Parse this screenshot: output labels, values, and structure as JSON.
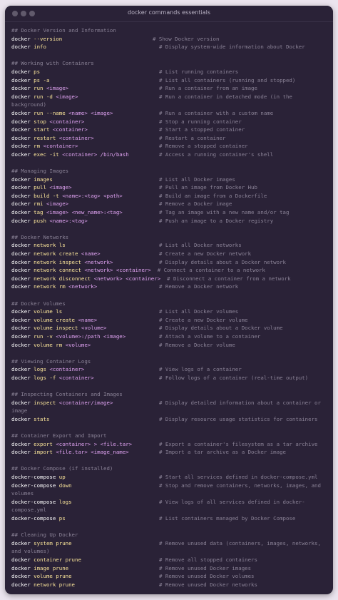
{
  "window": {
    "title": "docker commands essentials"
  },
  "sections": [
    {
      "heading": "## Docker Version and Information",
      "rows": [
        {
          "cmd": "docker",
          "kw": "--version",
          "args": "",
          "desc": "# Show Docker version",
          "shift": true
        },
        {
          "cmd": "docker",
          "kw": "info",
          "args": "",
          "desc": "# Display system-wide information about Docker"
        }
      ]
    },
    {
      "heading": "## Working with Containers",
      "rows": [
        {
          "cmd": "docker",
          "kw": "ps",
          "args": "",
          "desc": "# List running containers"
        },
        {
          "cmd": "docker",
          "kw": "ps -a",
          "args": "",
          "desc": "# List all containers (running and stopped)"
        },
        {
          "cmd": "docker",
          "kw": "run",
          "args": "<image>",
          "desc": "# Run a container from an image"
        },
        {
          "cmd": "docker",
          "kw": "run -d",
          "args": "<image>",
          "desc": "# Run a container in detached mode (in the",
          "wrap": "background)"
        },
        {
          "cmd": "docker",
          "kw": "run --name",
          "args": "<name> <image>",
          "desc": "# Run a container with a custom name"
        },
        {
          "cmd": "docker",
          "kw": "stop",
          "args": "<container>",
          "desc": "# Stop a running container"
        },
        {
          "cmd": "docker",
          "kw": "start",
          "args": "<container>",
          "desc": "# Start a stopped container"
        },
        {
          "cmd": "docker",
          "kw": "restart",
          "args": "<container>",
          "desc": "# Restart a container"
        },
        {
          "cmd": "docker",
          "kw": "rm",
          "args": "<container>",
          "desc": "# Remove a stopped container"
        },
        {
          "cmd": "docker",
          "kw": "exec -it",
          "args": "<container> /bin/bash",
          "desc": "# Access a running container's shell"
        }
      ]
    },
    {
      "heading": "## Managing Images",
      "rows": [
        {
          "cmd": "docker",
          "kw": "images",
          "args": "",
          "desc": "# List all Docker images"
        },
        {
          "cmd": "docker",
          "kw": "pull",
          "args": "<image>",
          "desc": "# Pull an image from Docker Hub"
        },
        {
          "cmd": "docker",
          "kw": "build -t",
          "args": "<name>:<tag> <path>",
          "desc": "# Build an image from a Dockerfile"
        },
        {
          "cmd": "docker",
          "kw": "rmi",
          "args": "<image>",
          "desc": "# Remove a Docker image"
        },
        {
          "cmd": "docker",
          "kw": "tag",
          "args": "<image> <new_name>:<tag>",
          "desc": "# Tag an image with a new name and/or tag"
        },
        {
          "cmd": "docker",
          "kw": "push",
          "args": "<name>:<tag>",
          "desc": "# Push an image to a Docker registry"
        }
      ]
    },
    {
      "heading": "## Docker Networks",
      "rows": [
        {
          "cmd": "docker",
          "kw": "network ls",
          "args": "",
          "desc": "# List all Docker networks"
        },
        {
          "cmd": "docker",
          "kw": "network create",
          "args": "<name>",
          "desc": "# Create a new Docker network"
        },
        {
          "cmd": "docker",
          "kw": "network inspect",
          "args": "<network>",
          "desc": "# Display details about a Docker network"
        },
        {
          "cmd": "docker",
          "kw": "network connect",
          "args": "<network> <container>",
          "desc": "  # Connect a container to a network",
          "inline": true
        },
        {
          "cmd": "docker",
          "kw": "network disconnect",
          "args": "<network> <container>",
          "desc": "  # Disconnect a container from a network",
          "inline": true
        },
        {
          "cmd": "docker",
          "kw": "network rm",
          "args": "<network>",
          "desc": "# Remove a Docker network"
        }
      ]
    },
    {
      "heading": "## Docker Volumes",
      "rows": [
        {
          "cmd": "docker",
          "kw": "volume ls",
          "args": "",
          "desc": "# List all Docker volumes"
        },
        {
          "cmd": "docker",
          "kw": "volume create",
          "args": "<name>",
          "desc": "# Create a new Docker volume"
        },
        {
          "cmd": "docker",
          "kw": "volume inspect",
          "args": "<volume>",
          "desc": "# Display details about a Docker volume"
        },
        {
          "cmd": "docker",
          "kw": "run -v",
          "args": "<volume>:/path <image>",
          "desc": "# Attach a volume to a container"
        },
        {
          "cmd": "docker",
          "kw": "volume rm",
          "args": "<volume>",
          "desc": "# Remove a Docker volume"
        }
      ]
    },
    {
      "heading": "## Viewing Container Logs",
      "rows": [
        {
          "cmd": "docker",
          "kw": "logs",
          "args": "<container>",
          "desc": "# View logs of a container"
        },
        {
          "cmd": "docker",
          "kw": "logs -f",
          "args": "<container>",
          "desc": "# Follow logs of a container (real-time output)"
        }
      ]
    },
    {
      "heading": "## Inspecting Containers and Images",
      "rows": [
        {
          "cmd": "docker",
          "kw": "inspect",
          "args": "<container/image>",
          "desc": "# Display detailed information about a container or",
          "wrap": "image"
        },
        {
          "cmd": "docker",
          "kw": "stats",
          "args": "",
          "desc": "# Display resource usage statistics for containers"
        }
      ]
    },
    {
      "heading": "## Container Export and Import",
      "rows": [
        {
          "cmd": "docker",
          "kw": "export",
          "args": "<container> > <file.tar>",
          "desc": "# Export a container's filesystem as a tar archive"
        },
        {
          "cmd": "docker",
          "kw": "import",
          "args": "<file.tar> <image_name>",
          "desc": "# Import a tar archive as a Docker image"
        }
      ]
    },
    {
      "heading": "## Docker Compose (if installed)",
      "rows": [
        {
          "cmd": "docker-compose",
          "kw": "up",
          "args": "",
          "desc": "# Start all services defined in docker-compose.yml"
        },
        {
          "cmd": "docker-compose",
          "kw": "down",
          "args": "",
          "desc": "# Stop and remove containers, networks, images, and",
          "wrap": "volumes"
        },
        {
          "cmd": "docker-compose",
          "kw": "logs",
          "args": "",
          "desc": "# View logs of all services defined in docker-",
          "wrap": "compose.yml"
        },
        {
          "cmd": "docker-compose",
          "kw": "ps",
          "args": "",
          "desc": "# List containers managed by Docker Compose"
        }
      ]
    },
    {
      "heading": "## Cleaning Up Docker",
      "rows": [
        {
          "cmd": "docker",
          "kw": "system prune",
          "args": "",
          "desc": "# Remove unused data (containers, images, networks,",
          "wrap": "and volumes)",
          "wrapIndent": true
        },
        {
          "cmd": "docker",
          "kw": "container prune",
          "args": "",
          "desc": "# Remove all stopped containers"
        },
        {
          "cmd": "docker",
          "kw": "image prune",
          "args": "",
          "desc": "# Remove unused Docker images"
        },
        {
          "cmd": "docker",
          "kw": "volume prune",
          "args": "",
          "desc": "# Remove unused Docker volumes"
        },
        {
          "cmd": "docker",
          "kw": "network prune",
          "args": "",
          "desc": "# Remove unused Docker networks"
        }
      ]
    }
  ],
  "colors": {
    "background": "#2a2237",
    "comment": "#8a8296",
    "command": "#ffffff",
    "keyword": "#fbe59a",
    "argument": "#e0a3f2"
  }
}
